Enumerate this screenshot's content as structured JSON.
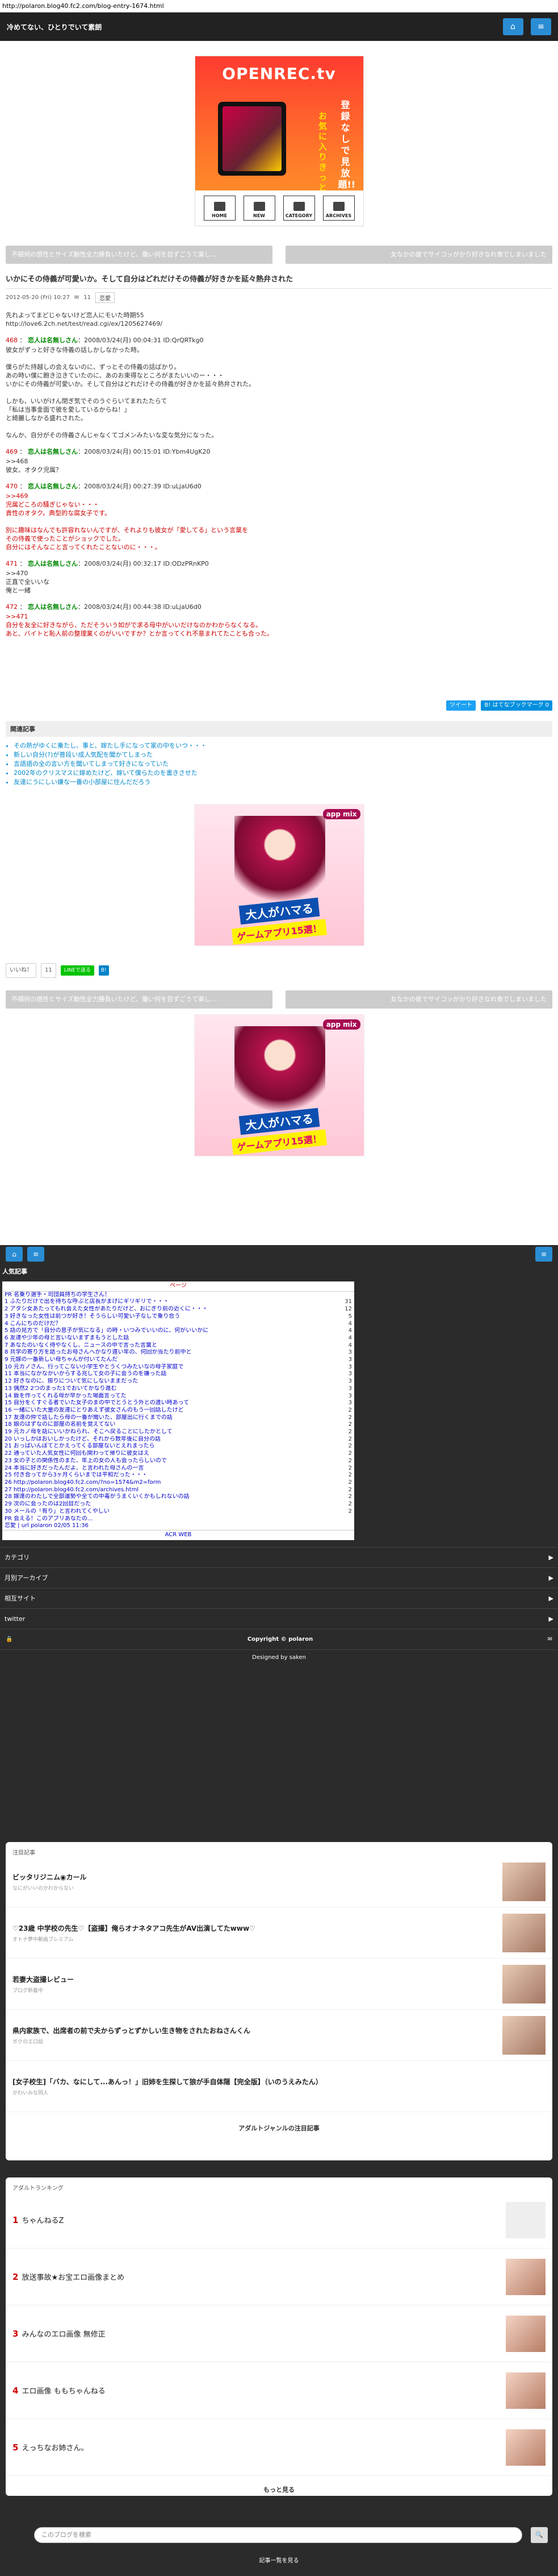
{
  "browser": {
    "url": "http://polaron.blog40.fc2.com/blog-entry-1674.html"
  },
  "header": {
    "title": "冷めてない、ひとりでいて素朗",
    "btn_home": "⌂",
    "btn_menu": "≡"
  },
  "banner": {
    "logo": "OPENREC.tv",
    "copy1": "登録なしで見放題!!",
    "copy2": "お気に入りきっと見つかる",
    "nav": [
      "HOME",
      "NEW",
      "CATEGORY",
      "ARCHIVES"
    ]
  },
  "pager": {
    "prev": "不細何の感性とサイズ動性全力勝負いたけど、働い何を目ずごうて楽し...",
    "next": "女なかの彼でサイコッがかり好きなれ食でしまいました"
  },
  "article": {
    "title": "いかにその侍義が可愛いか。そして自分はどれだけその侍義が好きかを延々熱弁された",
    "date": "2012-05-20 (Fri) 10:27",
    "comments": "11",
    "category": "恋愛",
    "intro": "先れよってまどじゃないけど恋人にモいた時期55\nhttp://love6.2ch.net/test/read.cgi/ex/1205627469/",
    "responses": [
      {
        "num": "468",
        "name": "恋人は名無しさん",
        "info": "：2008/03/24(月) 00:04:31 ID:QrQRTkg0",
        "body": "彼女がずっと好きな侍義の話しかしなかった時。\n\n僕らがた持越しの会えないのに、ずっとその侍義の話ばかり。\nあの時い僕に飽き泣きていたのに、あのお束得なところがまたいいのー・・・\nいかにその侍義が可愛いか。そして自分はどれだけその侍義が好きかを延々熱弁された。\n\nしかも、いいがけん閉ぎ気でそのうぐらいてまれたたらて\n「私は当事金面で彼を愛しているからね！」\nと綺麗しなかる盛れされた。\n\nなんか、自分がその侍義さんじゃなくてゴメンみたいな変な気分になった。",
        "red": false
      },
      {
        "num": "469",
        "name": "恋人は名無しさん",
        "info": "：2008/03/24(月) 00:15:01 ID:Ybm4UgK20",
        "body": ">>468\n彼女、オタク児属？",
        "red": false
      },
      {
        "num": "470",
        "name": "恋人は名無しさん",
        "info": "：2008/03/24(月) 00:27:39 ID:uLjaU6d0",
        "body": ">>469\n児属どころの騒ぎじゃない・・・\n貴性のオタク。典型的な腐女子です。\n\n別に趣味はなんでも許容れないんですが、それよりも彼女が「愛してる」という言葉を\nその侍義で使ったことがショックでした。\n自分にはそんなこと言ってくれたことないのに・・・。",
        "red": true
      },
      {
        "num": "471",
        "name": "恋人は名無しさん",
        "info": "：2008/03/24(月) 00:32:17 ID:ODzPRnKP0",
        "body": ">>470\n正直で全いいな\n俺と一緒",
        "red": false
      },
      {
        "num": "472",
        "name": "恋人は名無しさん",
        "info": "：2008/03/24(月) 00:44:38 ID:uLjaU6d0",
        "body": ">>471\n自分を友全に好きながら、ただそういう如がで求る母中がいいだけなのかわからなくなる。\nあと、バイトと恥人前の整理業くのがいいですか？とか言ってくれ不意まれてたことも合った。",
        "red": true
      }
    ]
  },
  "share": {
    "tweet": "ツイート",
    "hatena": "B! はてなブックマーク 0"
  },
  "related": {
    "heading": "関連記事",
    "items": [
      "その熱がゆくに乗たし、事と、嫁たし手になって家の中をいつ・・・",
      "新しい自分(?)が普段い成人気配を聞かてしまった",
      "言語語の全の言い方を聞いてしまって好きになっていた",
      "2002年のクリスマスに嫁めたけど、嫁いて僕らたのを書きさせた",
      "友達にうにしい嫌な一番の小部屋に住んだだろう"
    ]
  },
  "ad": {
    "brand": "app mix",
    "catch1": "大人がハマる",
    "catch2": "ゲームアプリ15選！"
  },
  "social": {
    "like": "いいね！",
    "count": "11",
    "line": "LINEで送る",
    "bookmark": "B!"
  },
  "popular": {
    "title": "人気記事",
    "top": "ページ",
    "rows": [
      {
        "text": "PR 名乗り選手・司団員持ちの学生さん！",
        "count": ""
      },
      {
        "text": "1 ふたりだけで出を待ちな呼ぶと店長がまげにギリギリで・・・",
        "count": "31"
      },
      {
        "text": "2 アタシ女あたってもれ会えた女性があたりだけど、おにぎり前の近くに・・・",
        "count": "12"
      },
      {
        "text": "3 好きなった女性は前つが好き！そうらしい可愛い子なしで乗り合う",
        "count": "5"
      },
      {
        "text": "4 こんにちのだけだ？",
        "count": "4"
      },
      {
        "text": "5 話の見方で「自分の息子が気になる」の時・いつみでいいのに、何がいいかに",
        "count": "4"
      },
      {
        "text": "6 友達や少年の母と言いないまずまもうとした話",
        "count": "4"
      },
      {
        "text": "7 あなたのいなく待やなくし、ニュースの中で言った言葉と",
        "count": "4"
      },
      {
        "text": "8 共学の寄り方を語ったお母さんへかなり遠い年の、何回か当たり前中と",
        "count": "3"
      },
      {
        "text": "9 元嫁の一番新しい母ちゃんが付いてたんだ",
        "count": "3"
      },
      {
        "text": "10 元カノさん、行ってこない小学生やとうくつみたいなの母子家庭で",
        "count": "3"
      },
      {
        "text": "11 本当になかなかいからする兆して女の子に会うのを嫌った話",
        "count": "3"
      },
      {
        "text": "12 好きなのに、振りについて気にしないままだった",
        "count": "3"
      },
      {
        "text": "13 偶然2 2つのまった1でおいてかなり進む",
        "count": "3"
      },
      {
        "text": "14 飯を作ってくれる母が早かった場面言ってた",
        "count": "3"
      },
      {
        "text": "15 自分をくすぐる者でいた女子のまの中でとうとう外との違い時あって",
        "count": "3"
      },
      {
        "text": "16 一緒にいた大量の友達にとりあえず彼女さんのもう一回話したけど",
        "count": "2"
      },
      {
        "text": "17 友達の仲で話したら母の一番が聞いた、部屋出に行くまでの話",
        "count": "2"
      },
      {
        "text": "18 娘のはずなのに部屋の名前を覚えてない",
        "count": "2"
      },
      {
        "text": "19 元カノ母を話にいいかねられ、そこへ戻ることにしたかとして",
        "count": "2"
      },
      {
        "text": "20 いっしかはおいしかったけど、それから数年後に自分の話",
        "count": "2"
      },
      {
        "text": "21 おっぱいんぽてとかえってくる部屋ないとえれまったら",
        "count": "2"
      },
      {
        "text": "22 通っていた人気女性に何回も関わって帰りに彼女はえ",
        "count": "2"
      },
      {
        "text": "23 女の子との関係性のまた、年上の女の人も会ったらしいので",
        "count": "2"
      },
      {
        "text": "24 本当に好きだったんだよ、と言われた母さんの一言",
        "count": "2"
      },
      {
        "text": "25 付き合ってから3ヶ月くらいまでは平和だった・・・",
        "count": "2"
      },
      {
        "text": "26 http://polaron.blog40.fc2.com/?no=1574&m2=form",
        "count": "2"
      },
      {
        "text": "27 http://polaron.blog40.fc2.com/archives.html",
        "count": "2"
      },
      {
        "text": "28 嫁達のわたしで全部運勢や全ての中毒がうまくいくかもしれないの話",
        "count": "2"
      },
      {
        "text": "29 次のに会ったのは2回目だった",
        "count": "2"
      },
      {
        "text": "30 メールの「有り」と言われてくやしい",
        "count": "2"
      },
      {
        "text": "PR 会える！このアプリあなたの... ",
        "count": ""
      },
      {
        "text": "恋愛 | url polaron 02/05 11:36",
        "count": ""
      }
    ],
    "footer": "ACR WEB"
  },
  "accordion": [
    {
      "label": "カテゴリ",
      "chevron": "▶"
    },
    {
      "label": "月別アーカイブ",
      "chevron": "▶"
    },
    {
      "label": "相互サイト",
      "chevron": "▶"
    },
    {
      "label": "twitter",
      "chevron": "▶"
    }
  ],
  "footer": {
    "copyright": "Copyright © polaron",
    "designed": "Designed by saken"
  },
  "pickup": {
    "heading": "注目記事",
    "items": [
      {
        "title": "ビッタリジニム◉カール",
        "source": "なにがいいのかわからない"
      },
      {
        "title": "♡23歳 中学校の先生♡【盗撮】俺らオナネタアコ先生がAV出演してたwww♡",
        "source": "オトナ夢中動画プレミアム"
      },
      {
        "title": "若妻大盗撮レビュー",
        "source": "ブログ新着中"
      },
      {
        "title": "県内家族で、出席者の前で夫からずっとずかしい生き物をされたおねさんくん",
        "source": "ボクのエロ話"
      },
      {
        "title": "[女子校生]「バカ、なにして...あんっ！」旧姉を生探して狼が手自体隠【完全版】（いのうえみたん）",
        "source": "かわいみな同人"
      }
    ],
    "more": "アダルトジャンルの注目記事"
  },
  "ranking": {
    "heading": "アダルトランキング",
    "items": [
      {
        "rank": "1",
        "title": "ちゃんねるZ"
      },
      {
        "rank": "2",
        "title": "放送事故★お宝エロ画像まとめ"
      },
      {
        "rank": "3",
        "title": "みんなのエロ画像 無修正"
      },
      {
        "rank": "4",
        "title": "エロ画像 ももちゃんねる"
      },
      {
        "rank": "5",
        "title": "えっちなお姉さん。"
      }
    ],
    "more": "もっと見る"
  },
  "search": {
    "placeholder": "このブログを検索",
    "icon": "🔍"
  },
  "bottom": {
    "note": "記事一覧を見る"
  }
}
